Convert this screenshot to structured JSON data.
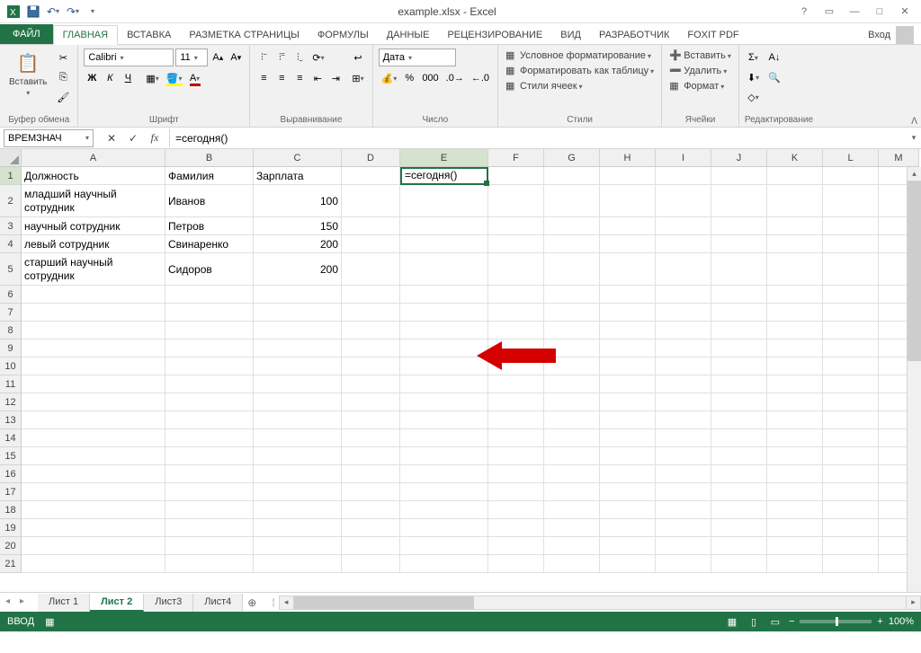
{
  "title": "example.xlsx - Excel",
  "signin": "Вход",
  "tabs": {
    "file": "ФАЙЛ",
    "items": [
      "ГЛАВНАЯ",
      "ВСТАВКА",
      "РАЗМЕТКА СТРАНИЦЫ",
      "ФОРМУЛЫ",
      "ДАННЫЕ",
      "РЕЦЕНЗИРОВАНИЕ",
      "ВИД",
      "РАЗРАБОТЧИК",
      "FOXIT PDF"
    ],
    "active": 0
  },
  "ribbon": {
    "clipboard": {
      "label": "Буфер обмена",
      "paste": "Вставить"
    },
    "font": {
      "label": "Шрифт",
      "name": "Calibri",
      "size": "11",
      "bold": "Ж",
      "italic": "К",
      "underline": "Ч"
    },
    "align": {
      "label": "Выравнивание"
    },
    "number": {
      "label": "Число",
      "format": "Дата"
    },
    "styles": {
      "label": "Стили",
      "cond": "Условное форматирование",
      "table": "Форматировать как таблицу",
      "cell": "Стили ячеек"
    },
    "cells": {
      "label": "Ячейки",
      "insert": "Вставить",
      "delete": "Удалить",
      "format": "Формат"
    },
    "editing": {
      "label": "Редактирование"
    }
  },
  "namebox": "ВРЕМЗНАЧ",
  "formula": "=сегодня()",
  "cols": [
    "A",
    "B",
    "C",
    "D",
    "E",
    "F",
    "G",
    "H",
    "I",
    "J",
    "K",
    "L",
    "M"
  ],
  "hdr": {
    "a": "Должность",
    "b": "Фамилия",
    "c": "Зарплата",
    "e": "=сегодня()"
  },
  "data": [
    {
      "a": "младший научный сотрудник",
      "b": "Иванов",
      "c": "100",
      "tall": true
    },
    {
      "a": "научный сотрудник",
      "b": "Петров",
      "c": "150"
    },
    {
      "a": "левый сотрудник",
      "b": "Свинаренко",
      "c": "200"
    },
    {
      "a": "старший научный сотрудник",
      "b": "Сидоров",
      "c": "200",
      "tall": true
    }
  ],
  "sheets": [
    "Лист 1",
    "Лист 2",
    "Лист3",
    "Лист4"
  ],
  "sheet_active": 1,
  "status": "ВВОД",
  "zoom": "100%"
}
